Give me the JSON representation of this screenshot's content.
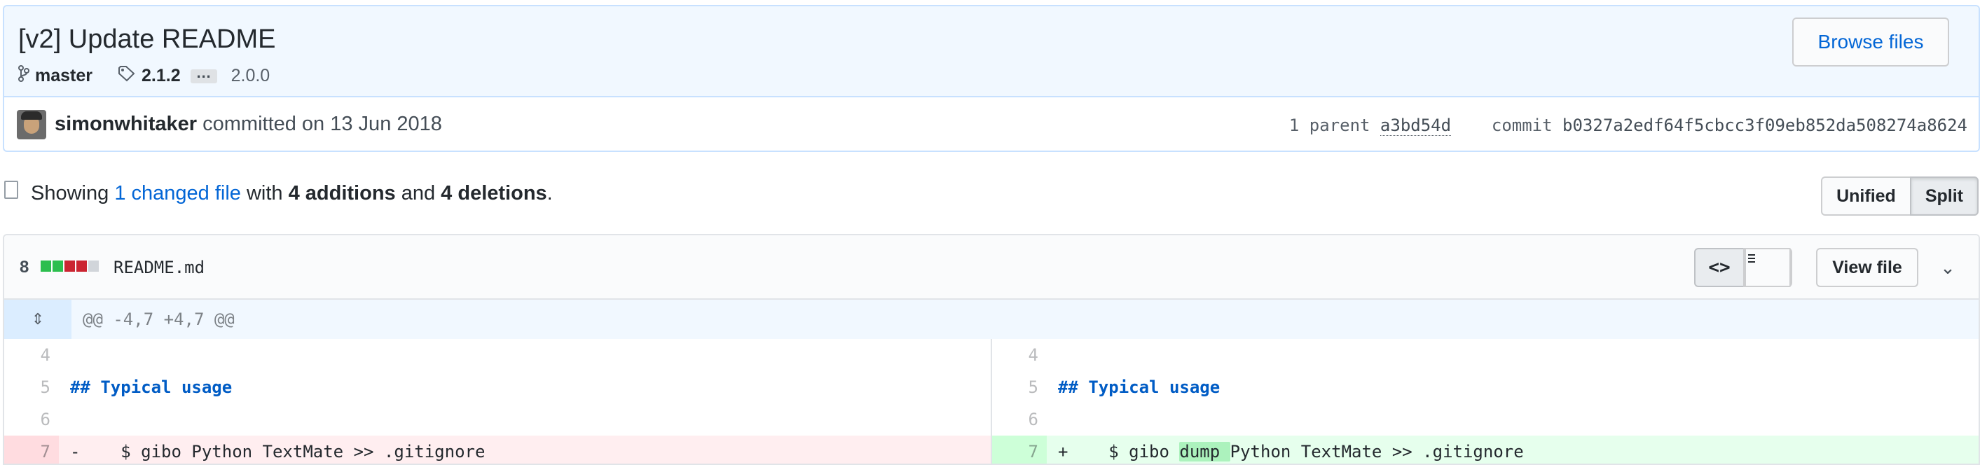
{
  "commit": {
    "title": "[v2] Update README",
    "branch": "master",
    "tag": "2.1.2",
    "tags_more": "…",
    "tag_older": "2.0.0",
    "browse_label": "Browse files",
    "author": "simonwhitaker",
    "committed_text": " committed on 13 Jun 2018",
    "parent_label": "1 parent",
    "parent_sha": "a3bd54d",
    "commit_label": "commit",
    "commit_sha": "b0327a2edf64f5cbcc3f09eb852da508274a8624"
  },
  "toc": {
    "showing": "Showing ",
    "changed_files": "1 changed file",
    "with": " with ",
    "additions": "4 additions",
    "and": " and ",
    "deletions": "4 deletions",
    "period": ".",
    "unified_label": "Unified",
    "split_label": "Split"
  },
  "file": {
    "diffstat_count": "8",
    "name": "README.md",
    "source_toggle": "<>",
    "view_file_label": "View file",
    "chevron": "⌄",
    "hunk_header": "@@ -4,7 +4,7 @@",
    "expand_glyph": "⇕",
    "rows": [
      {
        "left_num": "4",
        "left_code": "",
        "right_num": "4",
        "right_code": ""
      },
      {
        "left_num": "5",
        "left_code": "## Typical usage",
        "right_num": "5",
        "right_code": "## Typical usage"
      },
      {
        "left_num": "6",
        "left_code": "",
        "right_num": "6",
        "right_code": ""
      },
      {
        "left_num": "7",
        "left_code": "-    $ gibo Python TextMate >> .gitignore",
        "right_num": "7",
        "right_code_pre": "+    $ gibo ",
        "right_code_hl": "dump ",
        "right_code_post": "Python TextMate >> .gitignore"
      }
    ]
  },
  "colors": {
    "accent": "#0366d6",
    "del_bg": "#ffeef0",
    "add_bg": "#e6ffed",
    "add_highlight": "#acf2bd"
  }
}
